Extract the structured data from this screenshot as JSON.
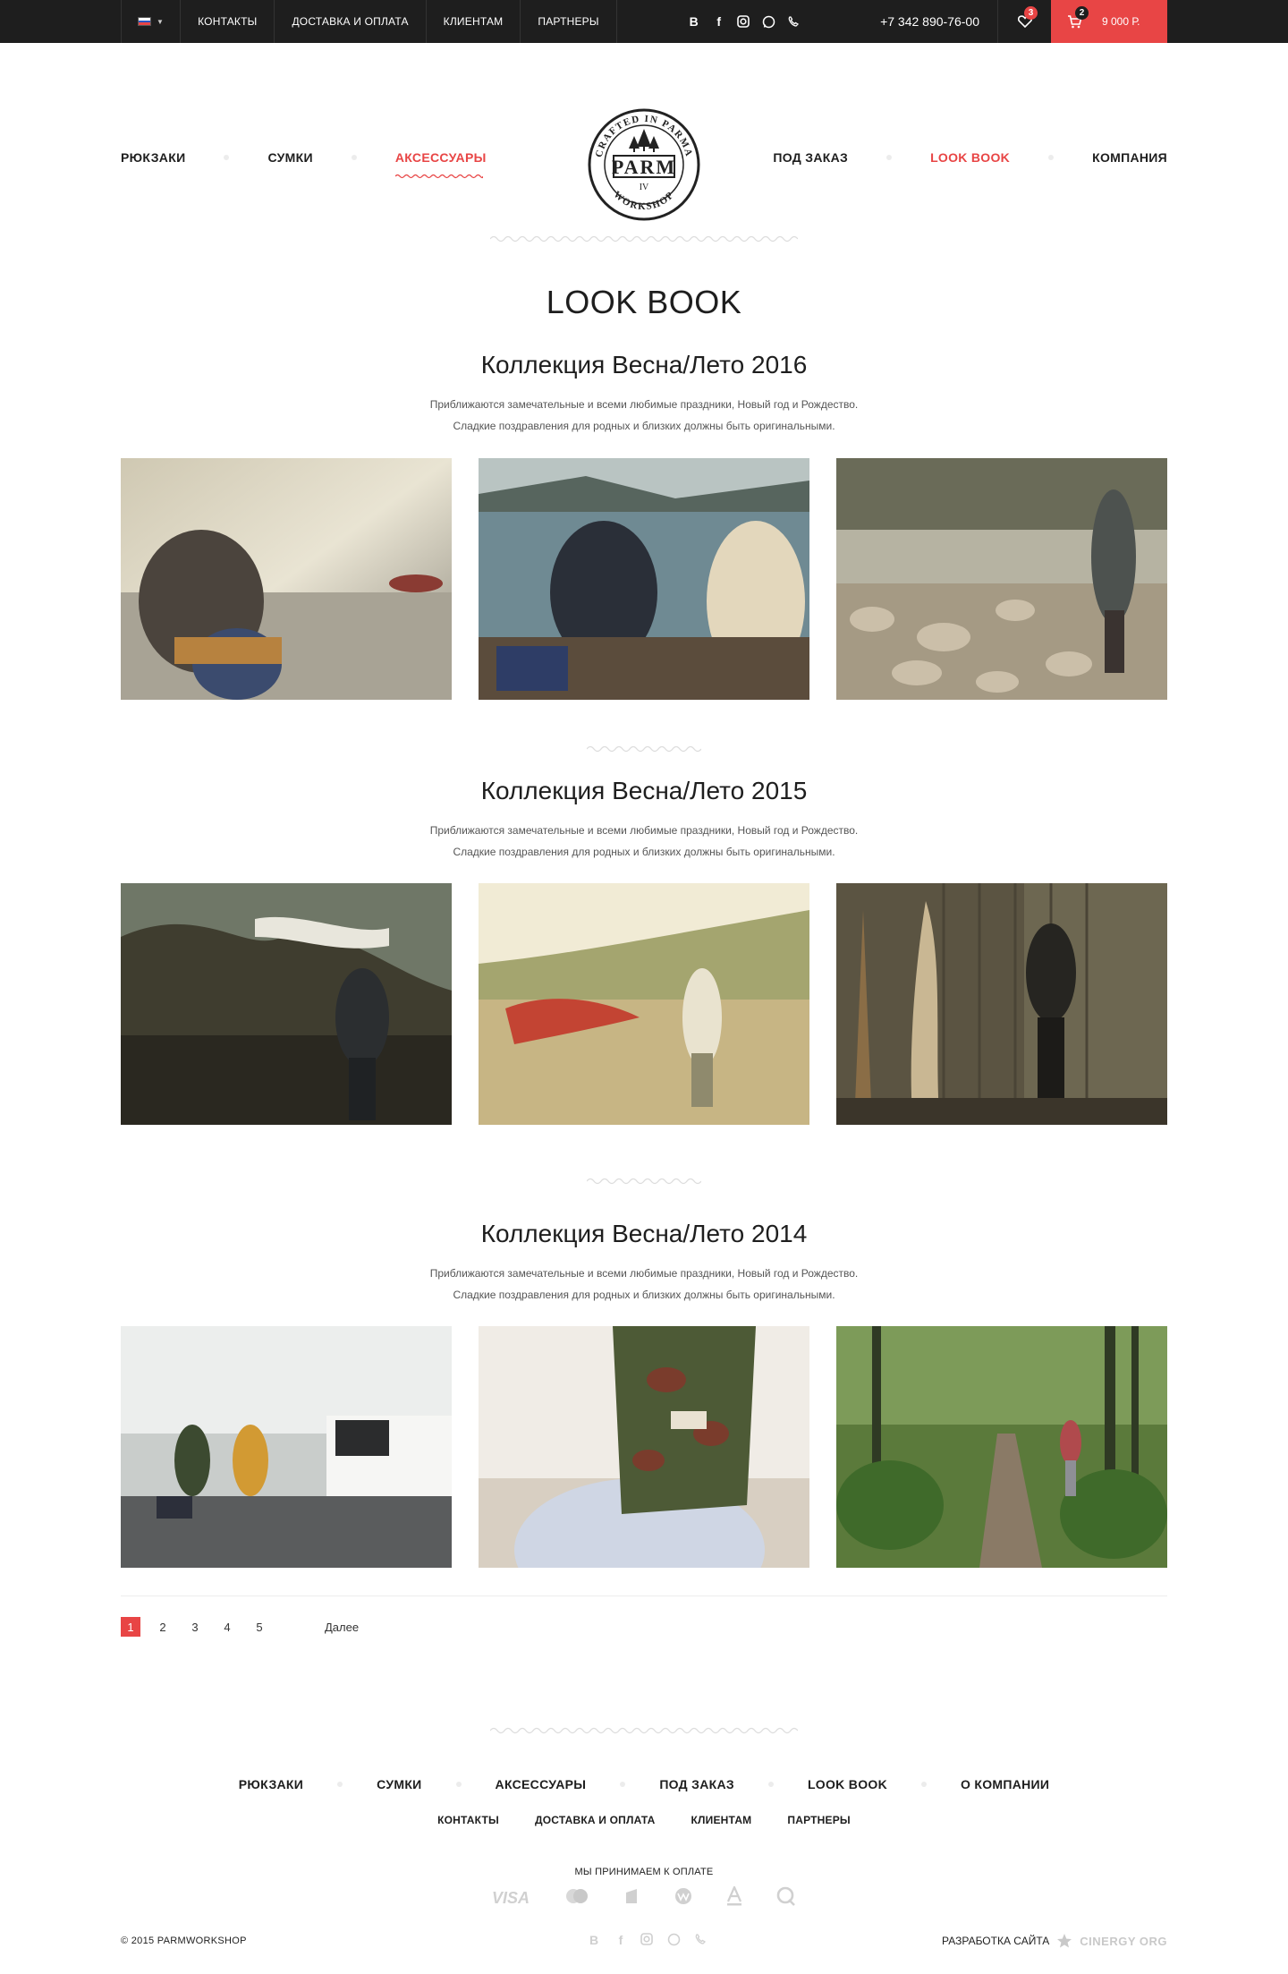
{
  "topbar": {
    "lang_flag_colors": [
      "#ffffff",
      "#2c56c4",
      "#e84545"
    ],
    "links": [
      "КОНТАКТЫ",
      "ДОСТАВКА И ОПЛАТА",
      "КЛИЕНТАМ",
      "ПАРТНЕРЫ"
    ],
    "socials": [
      "vk-icon",
      "facebook-icon",
      "instagram-icon",
      "whatsapp-icon",
      "viber-icon"
    ],
    "phone": "+7 342 890-76-00",
    "favorites_count": "3",
    "cart_count": "2",
    "cart_total": "9 000 Р."
  },
  "nav": {
    "left": [
      "РЮКЗАКИ",
      "СУМКИ",
      "АКСЕССУАРЫ"
    ],
    "right": [
      "ПОД ЗАКАЗ",
      "LOOK BOOK",
      "КОМПАНИЯ"
    ],
    "active_left": "АКСЕССУАРЫ",
    "active_right": "LOOK BOOK"
  },
  "logo": {
    "top_text": "CRAFTED IN PARMA",
    "main_text": "PARM",
    "number": "IV",
    "bottom_text": "WORKSHOP"
  },
  "page": {
    "title": "LOOK BOOK"
  },
  "collections": [
    {
      "title": "Коллекция Весна/Лето 2016",
      "desc_line1": "Приближаются замечательные и всеми любимые праздники, Новый год и Рождество.",
      "desc_line2": "Сладкие поздравления для родных и близких должны быть оригинальными."
    },
    {
      "title": "Коллекция Весна/Лето 2015",
      "desc_line1": "Приближаются замечательные и всеми любимые праздники, Новый год и Рождество.",
      "desc_line2": "Сладкие поздравления для родных и близких должны быть оригинальными."
    },
    {
      "title": "Коллекция Весна/Лето 2014",
      "desc_line1": "Приближаются замечательные и всеми любимые праздники, Новый год и Рождество.",
      "desc_line2": "Сладкие поздравления для родных и близких должны быть оригинальными."
    }
  ],
  "pagination": {
    "pages": [
      "1",
      "2",
      "3",
      "4",
      "5"
    ],
    "active": "1",
    "next": "Далее"
  },
  "footer": {
    "nav_main": [
      "РЮКЗАКИ",
      "СУМКИ",
      "АКСЕССУАРЫ",
      "ПОД ЗАКАЗ",
      "LOOK BOOK",
      "О КОМПАНИИ"
    ],
    "nav_secondary": [
      "КОНТАКТЫ",
      "ДОСТАВКА И ОПЛАТА",
      "КЛИЕНТАМ",
      "ПАРТНЕРЫ"
    ],
    "payment_label": "МЫ ПРИНИМАЕМ К ОПЛАТЕ",
    "payment_visa": "VISA",
    "payment_icons": [
      "visa-icon",
      "mastercard-icon",
      "yandex-money-icon",
      "webmoney-icon",
      "alfa-bank-icon",
      "qiwi-icon"
    ],
    "copyright": "© 2015 PARMWORKSHOP",
    "dev_label": "РАЗРАБОТКА САЙТА",
    "dev_brand": "CINERGY ORG"
  },
  "colors": {
    "accent": "#e84545",
    "topbar_bg": "#1e1e1e"
  }
}
